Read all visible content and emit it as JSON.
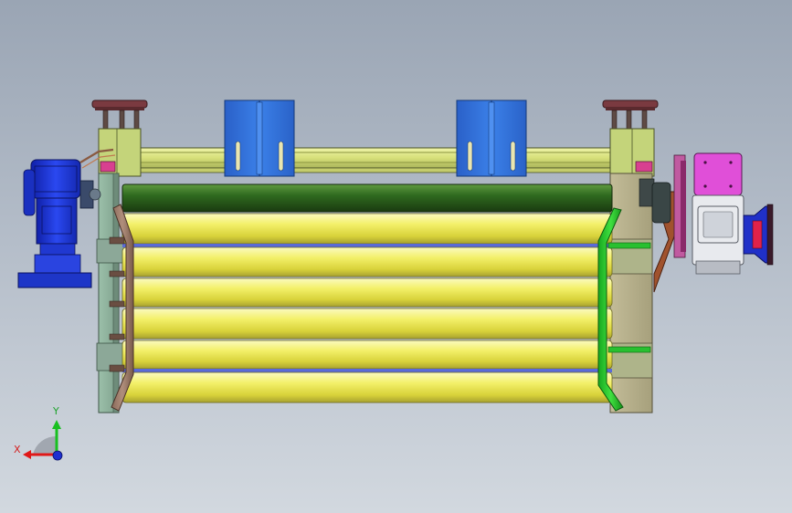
{
  "triad": {
    "x_label": "X",
    "y_label": "Y",
    "colors": {
      "x": "#e01818",
      "y": "#18c020",
      "z": "#1e2fd0"
    }
  },
  "colors": {
    "background_top": "#9aa5b4",
    "background_bottom": "#d2d8df",
    "roller_yellow": "#f2ef5a",
    "roller_green": "#2f6a1f",
    "bracket_blue": "#2f6fd8",
    "motor_blue": "#1a35d8",
    "gearbox_magenta": "#e04fd8",
    "frame_olive": "#d7e07a",
    "side_plate_tan": "#b4ad8a",
    "side_plate_teal": "#8eb19c"
  },
  "icons": [
    "coordinate-triad-icon"
  ]
}
